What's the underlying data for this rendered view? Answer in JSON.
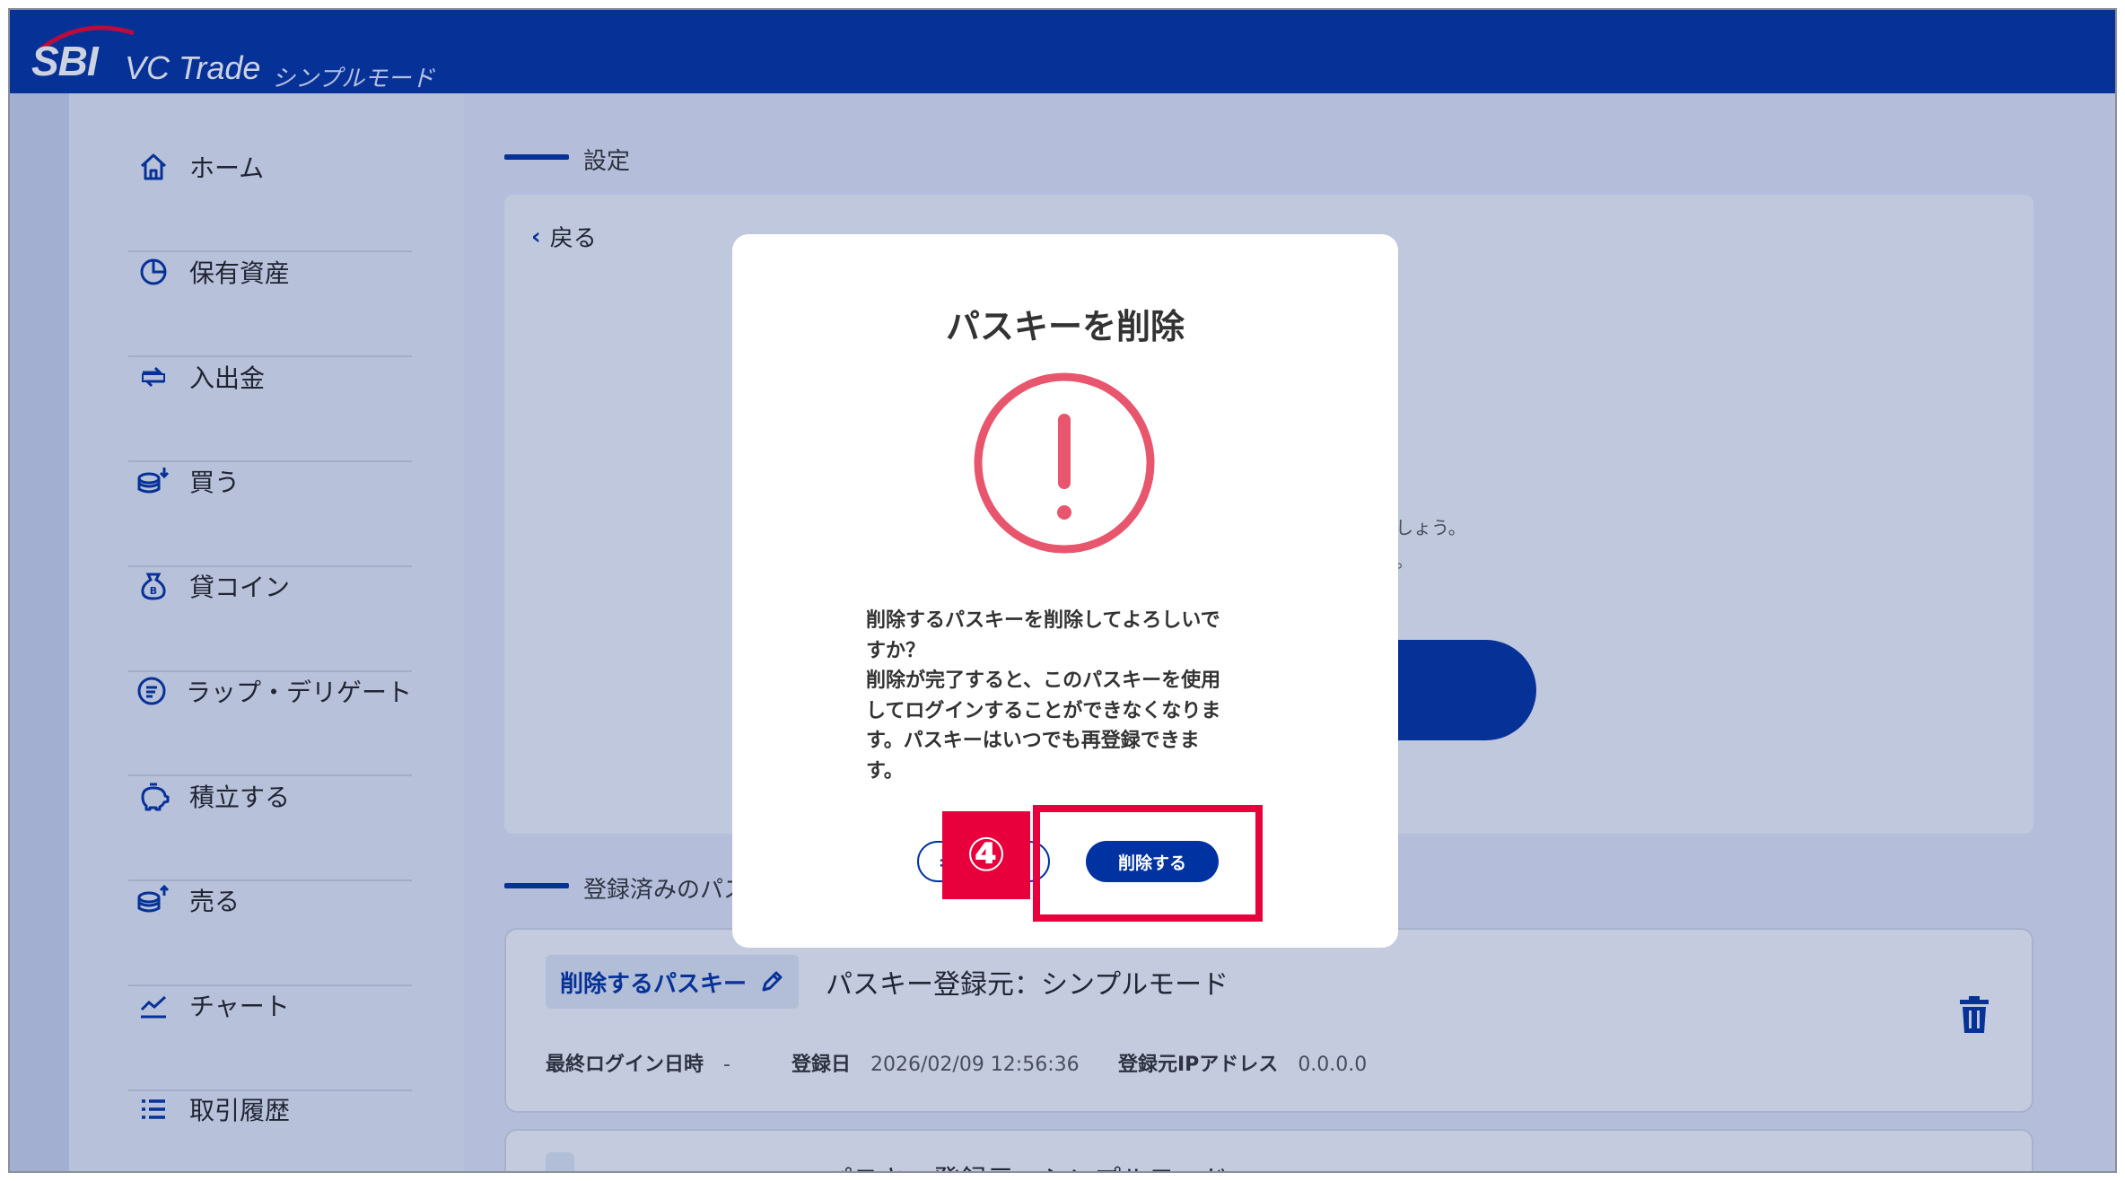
{
  "header": {
    "brand": "SBI",
    "product": "VC Trade",
    "mode": "シンプルモード"
  },
  "sidebar": {
    "items": [
      {
        "label": "ホーム",
        "icon": "home-icon"
      },
      {
        "label": "保有資産",
        "icon": "pie-chart-icon"
      },
      {
        "label": "入出金",
        "icon": "transfer-icon"
      },
      {
        "label": "買う",
        "icon": "coins-buy-icon"
      },
      {
        "label": "貸コイン",
        "icon": "bitcoin-bag-icon"
      },
      {
        "label": "ラップ・デリゲート",
        "icon": "wrap-icon"
      },
      {
        "label": "積立する",
        "icon": "piggy-bank-icon"
      },
      {
        "label": "売る",
        "icon": "coins-sell-icon"
      },
      {
        "label": "チャート",
        "icon": "chart-line-icon"
      },
      {
        "label": "取引履歴",
        "icon": "list-icon"
      }
    ]
  },
  "main": {
    "section_title": "設定",
    "back_label": "戻る",
    "partial_text_1": "しょう。",
    "partial_text_2": "。",
    "registered_section_title": "登録済みのパス",
    "passkey": {
      "name": "削除するパスキー",
      "source": "パスキー登録元：シンプルモード",
      "last_login_label": "最終ログイン日時",
      "last_login_value": "-",
      "registered_label": "登録日",
      "registered_value": "2026/02/09 12:56:36",
      "ip_label": "登録元IPアドレス",
      "ip_value": "0.0.0.0"
    },
    "passkey2_partial": "パスキー登録元：シンプルモード"
  },
  "modal": {
    "title": "パスキーを削除",
    "body_lines": [
      "削除するパスキーを削除してよろしいで",
      "すか？",
      "削除が完了すると、このパスキーを使用",
      "してログインすることができなくなりま",
      "す。パスキーはいつでも再登録できま",
      "す。"
    ],
    "cancel_label": "キャンセル",
    "confirm_label": "削除する",
    "alert_color": "#e8566e"
  },
  "annotation": {
    "step": "④",
    "color": "#e8003c"
  },
  "colors": {
    "brand_blue": "#0033a1",
    "page_bg": "#dfe6f6"
  }
}
